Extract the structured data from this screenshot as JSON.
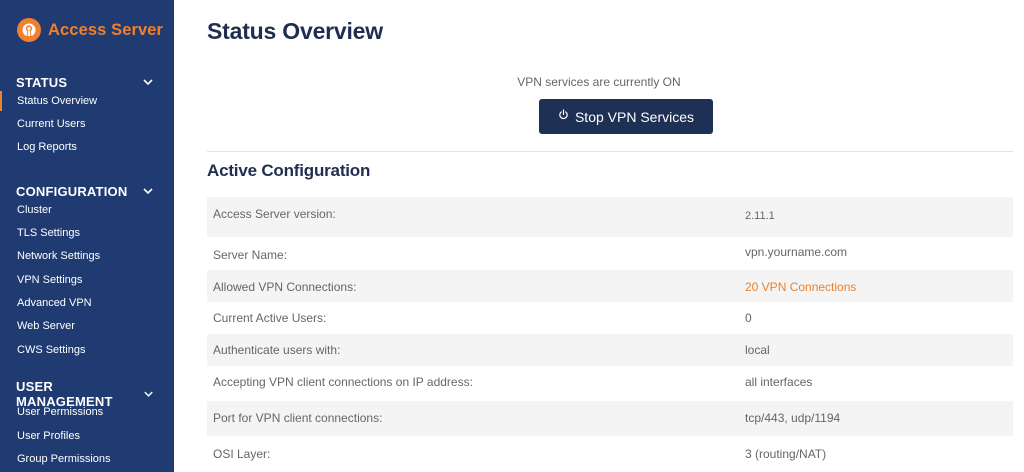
{
  "brand": {
    "name": "Access Server",
    "accent_color": "#f07f2e",
    "sidebar_color": "#1f3b71"
  },
  "sidebar": {
    "sections": [
      {
        "title": "STATUS",
        "items": [
          "Status Overview",
          "Current Users",
          "Log Reports"
        ]
      },
      {
        "title": "CONFIGURATION",
        "items": [
          "Cluster",
          "TLS Settings",
          "Network Settings",
          "VPN Settings",
          "Advanced VPN",
          "Web Server",
          "CWS Settings"
        ]
      },
      {
        "title": "USER MANAGEMENT",
        "items": [
          "User Permissions",
          "User Profiles",
          "Group Permissions"
        ]
      }
    ],
    "active_item": "Status Overview"
  },
  "main": {
    "title": "Status Overview",
    "vpn_status_text": "VPN services are currently ON",
    "stop_button_label": "Stop VPN Services",
    "config_title": "Active Configuration",
    "config_rows": [
      {
        "label": "Access Server version:",
        "value": "2.11.1"
      },
      {
        "label": "Server Name:",
        "value": "vpn.yourname.com"
      },
      {
        "label": "Allowed VPN Connections:",
        "value": "20 VPN Connections"
      },
      {
        "label": "Current Active Users:",
        "value": "0"
      },
      {
        "label": "Authenticate users with:",
        "value": "local"
      },
      {
        "label": "Accepting VPN client connections on IP address:",
        "value": "all interfaces"
      },
      {
        "label": "Port for VPN client connections:",
        "value": "tcp/443, udp/1194"
      },
      {
        "label": "OSI Layer:",
        "value": "3 (routing/NAT)"
      }
    ]
  }
}
